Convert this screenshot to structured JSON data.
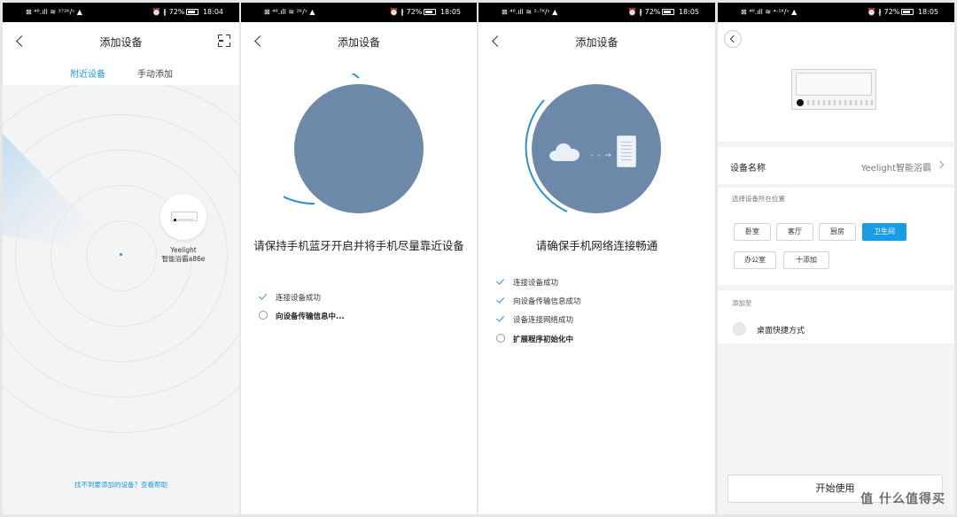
{
  "screens": [
    {
      "status": {
        "left": "⊠ ⁴⁶.ıll ≋ ³⁷²ᴷ/ˢ ▲",
        "right_icons": "⏰ ∦",
        "battery": "72%",
        "time": "18:04"
      },
      "title": "添加设备",
      "tabs": [
        {
          "label": "附近设备",
          "active": true
        },
        {
          "label": "手动添加",
          "active": false
        }
      ],
      "device": {
        "brand": "Yeelight",
        "name": "智能浴霸a86e"
      },
      "help_link": "找不到要添加的设备？查看帮助"
    },
    {
      "status": {
        "left": "⊠ ⁴⁶.ıll ≋ ²ᴷ/ˢ ▲",
        "right_icons": "⏰ ∦",
        "battery": "72%",
        "time": "18:05"
      },
      "title": "添加设备",
      "prompt": "请保持手机蓝牙开启并将手机尽量靠近设备",
      "steps": [
        {
          "label": "连接设备成功",
          "state": "done"
        },
        {
          "label": "向设备传输信息中...",
          "state": "loading"
        }
      ]
    },
    {
      "status": {
        "left": "⊠ ⁴⁶.ıll ≋ ²·⁷ᴷ/ˢ ▲",
        "right_icons": "⏰ ∦",
        "battery": "72%",
        "time": "18:05"
      },
      "title": "添加设备",
      "prompt": "请确保手机网络连接畅通",
      "steps": [
        {
          "label": "连接设备成功",
          "state": "done"
        },
        {
          "label": "向设备传输信息成功",
          "state": "done"
        },
        {
          "label": "设备连接网络成功",
          "state": "done"
        },
        {
          "label": "扩展程序初始化中",
          "state": "loading"
        }
      ]
    },
    {
      "status": {
        "left": "⊠ ⁴⁶.ıll ≋ ⁴·¹ᴷ/ˢ ▲",
        "right_icons": "⏰ ∦",
        "battery": "72%",
        "time": "18:05"
      },
      "device_name_label": "设备名称",
      "device_name_value": "Yeelight智能浴霸",
      "location_title": "选择设备所在位置",
      "locations": [
        {
          "label": "卧室",
          "selected": false
        },
        {
          "label": "客厅",
          "selected": false
        },
        {
          "label": "厨房",
          "selected": false
        },
        {
          "label": "卫生间",
          "selected": true
        },
        {
          "label": "办公室",
          "selected": false
        },
        {
          "label": "十添加",
          "selected": false
        }
      ],
      "add_to_title": "添加至",
      "shortcut_label": "桌面快捷方式",
      "bottom_button": "开始使用",
      "watermark": "值 什么值得买"
    }
  ],
  "colors": {
    "accent": "#1a9be6",
    "circle": "#6d89aa",
    "check": "#2a8fdd"
  }
}
